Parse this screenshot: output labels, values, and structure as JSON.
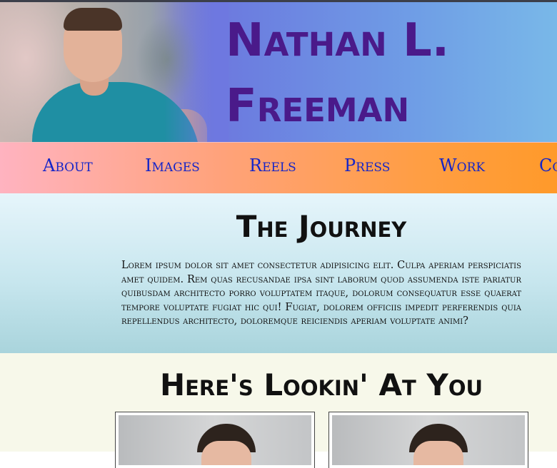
{
  "header": {
    "name_line1": "Nathan L.",
    "name_line2": "Freeman"
  },
  "nav": {
    "items": [
      "About",
      "Images",
      "Reels",
      "Press",
      "Work",
      "Co"
    ]
  },
  "journey": {
    "title": "The Journey",
    "body": "Lorem ipsum dolor sit amet consectetur adipisicing elit. Culpa aperiam perspiciatis amet quidem. Rem quas recusandae ipsa sint laborum quod assumenda iste pariatur quibusdam architecto porro voluptatem itaque, dolorum consequatur esse quaerat tempore voluptate fugiat hic qui! Fugiat, dolorem officiis impedit perferendis quia repellendus architecto, doloremque reiciendis aperiam voluptate animi?"
  },
  "gallery": {
    "title": "Here's Lookin' At You"
  },
  "colors": {
    "name": "#4a1a8a",
    "nav_link": "#1525c8"
  }
}
